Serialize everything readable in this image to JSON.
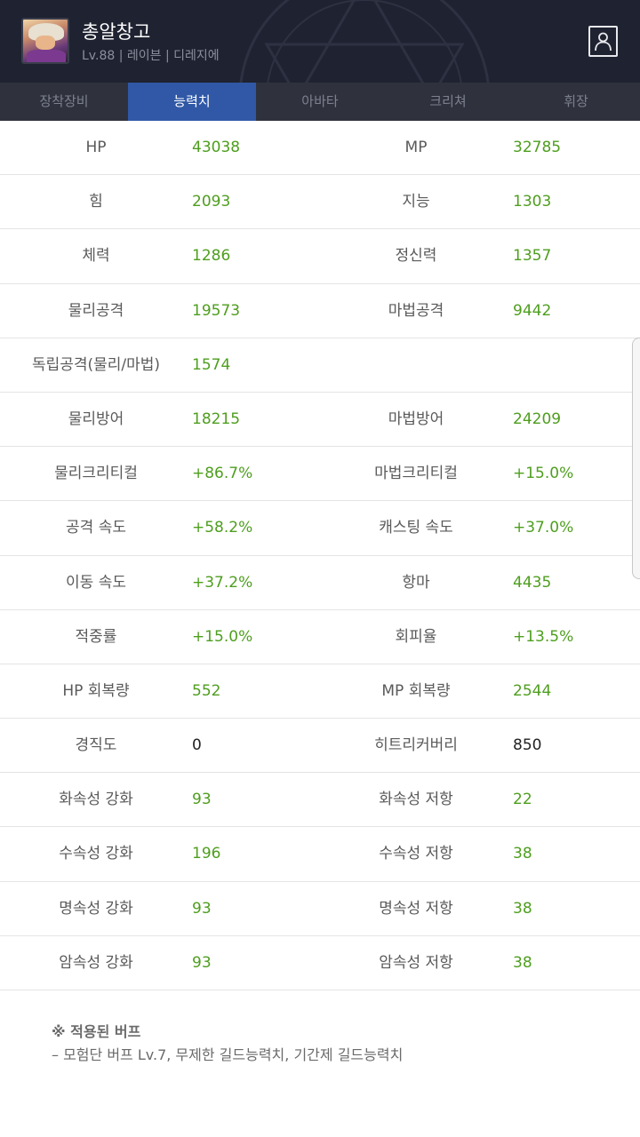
{
  "header": {
    "name": "총알창고",
    "info": "Lv.88 | 레이븐 | 디레지에"
  },
  "tabs": [
    {
      "label": "장착장비",
      "active": false
    },
    {
      "label": "능력치",
      "active": true
    },
    {
      "label": "아바타",
      "active": false
    },
    {
      "label": "크리쳐",
      "active": false
    },
    {
      "label": "휘장",
      "active": false
    }
  ],
  "stats": [
    {
      "l1": "HP",
      "v1": "43038",
      "l2": "MP",
      "v2": "32785"
    },
    {
      "l1": "힘",
      "v1": "2093",
      "l2": "지능",
      "v2": "1303"
    },
    {
      "l1": "체력",
      "v1": "1286",
      "l2": "정신력",
      "v2": "1357"
    },
    {
      "l1": "물리공격",
      "v1": "19573",
      "l2": "마법공격",
      "v2": "9442"
    },
    {
      "l1": "독립공격(물리/마법)",
      "v1": "1574",
      "l2": "",
      "v2": ""
    },
    {
      "l1": "물리방어",
      "v1": "18215",
      "l2": "마법방어",
      "v2": "24209"
    },
    {
      "l1": "물리크리티컬",
      "v1": "+86.7%",
      "l2": "마법크리티컬",
      "v2": "+15.0%"
    },
    {
      "l1": "공격 속도",
      "v1": "+58.2%",
      "l2": "캐스팅 속도",
      "v2": "+37.0%"
    },
    {
      "l1": "이동 속도",
      "v1": "+37.2%",
      "l2": "항마",
      "v2": "4435"
    },
    {
      "l1": "적중률",
      "v1": "+15.0%",
      "l2": "회피율",
      "v2": "+13.5%"
    },
    {
      "l1": "HP 회복량",
      "v1": "552",
      "l2": "MP 회복량",
      "v2": "2544"
    },
    {
      "l1": "경직도",
      "v1": "0",
      "l2": "히트리커버리",
      "v2": "850"
    },
    {
      "l1": "화속성 강화",
      "v1": "93",
      "l2": "화속성 저항",
      "v2": "22"
    },
    {
      "l1": "수속성 강화",
      "v1": "196",
      "l2": "수속성 저항",
      "v2": "38"
    },
    {
      "l1": "명속성 강화",
      "v1": "93",
      "l2": "명속성 저항",
      "v2": "38"
    },
    {
      "l1": "암속성 강화",
      "v1": "93",
      "l2": "암속성 저항",
      "v2": "38"
    }
  ],
  "buff": {
    "title": "※ 적용된 버프",
    "text": "– 모험단 버프 Lv.7, 무제한 길드능력치, 기간제 길드능력치"
  },
  "colors": {
    "header_bg": "#1f2230",
    "tab_bar_bg": "#2f323d",
    "tab_active_bg": "#3058a6",
    "value_green": "#4e9e1e",
    "value_black": "#222222"
  }
}
